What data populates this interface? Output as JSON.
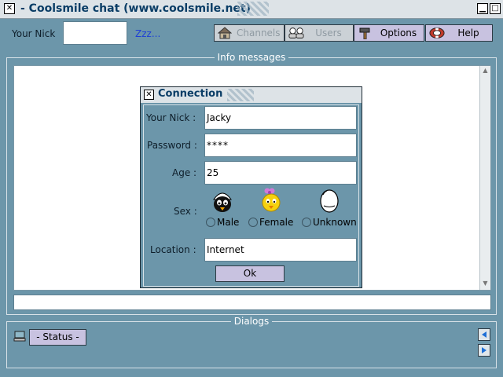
{
  "window": {
    "title": "- Coolsmile chat (www.coolsmile.net)",
    "close_glyph": "✕",
    "minimize_glyph": "▁",
    "maximize_glyph": "□"
  },
  "header": {
    "nick_label": "Your Nick",
    "nick_value": "",
    "status_text": "Zzz...",
    "buttons": [
      {
        "label": "Channels",
        "icon": "house-icon",
        "enabled": false
      },
      {
        "label": "Users",
        "icon": "users-icon",
        "enabled": false
      },
      {
        "label": "Options",
        "icon": "hammer-icon",
        "enabled": true
      },
      {
        "label": "Help",
        "icon": "lifebuoy-icon",
        "enabled": true
      }
    ]
  },
  "info": {
    "group_title": "Info messages"
  },
  "dialogs": {
    "group_title": "Dialogs",
    "status_button": "- Status -"
  },
  "connection_dialog": {
    "title": "Connection",
    "fields": {
      "nick_label": "Your Nick :",
      "nick_value": "Jacky",
      "password_label": "Password :",
      "password_value": "****",
      "age_label": "Age :",
      "age_value": "25",
      "sex_label": "Sex :",
      "location_label": "Location :",
      "location_value": "Internet"
    },
    "sex_options": [
      {
        "label": "Male",
        "icon": "male-chick-icon"
      },
      {
        "label": "Female",
        "icon": "female-chick-icon"
      },
      {
        "label": "Unknown",
        "icon": "egg-icon"
      }
    ],
    "ok_label": "Ok"
  },
  "colors": {
    "background": "#6c96aa",
    "title_text": "#0a3d66",
    "button_face": "#c8c2e0",
    "link_text": "#1d3fd6"
  }
}
